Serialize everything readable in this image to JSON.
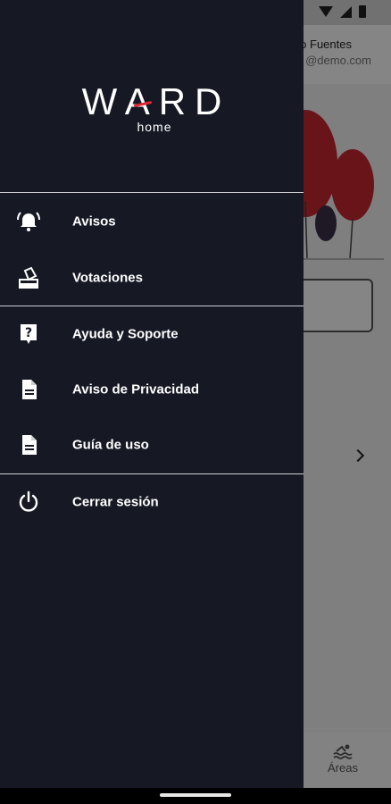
{
  "background": {
    "user_name": "o Fuentes",
    "user_email": "@demo.com",
    "bottom_nav_label": "Áreas"
  },
  "drawer": {
    "logo_text": "WARD",
    "logo_subtext": "home",
    "accent_color": "#e0262f",
    "items": [
      {
        "label": "Avisos",
        "icon": "alarm-bell-icon"
      },
      {
        "label": "Votaciones",
        "icon": "ballot-box-icon"
      },
      {
        "label": "Ayuda y Soporte",
        "icon": "help-icon"
      },
      {
        "label": "Aviso de Privacidad",
        "icon": "document-icon"
      },
      {
        "label": "Guía de uso",
        "icon": "document-icon"
      },
      {
        "label": "Cerrar sesión",
        "icon": "power-icon"
      }
    ]
  }
}
